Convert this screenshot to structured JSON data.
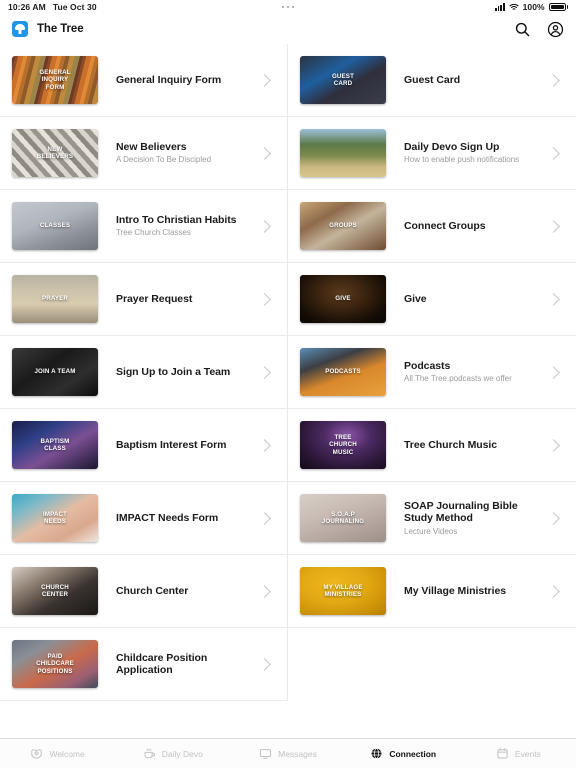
{
  "status_bar": {
    "time": "10:26 AM",
    "date": "Tue Oct 30",
    "battery_percent": "100%",
    "signal_icon": "cellular-signal-icon",
    "wifi_icon": "wifi-icon",
    "battery_icon": "battery-icon",
    "multitask_icon": "multitask-handle-icon"
  },
  "navbar": {
    "app_name": "The Tree",
    "logo_icon": "the-tree-logo-icon",
    "search_icon": "search-icon",
    "account_icon": "account-circle-icon",
    "brand_color": "#2196e8"
  },
  "list": {
    "chevron_icon": "chevron-right-icon",
    "items": [
      {
        "title": "General Inquiry Form",
        "subtitle": "",
        "thumb_label": "GENERAL\nINQUIRY\nFORM",
        "thumb_style": "general-inquiry",
        "column": "left"
      },
      {
        "title": "Guest Card",
        "subtitle": "",
        "thumb_label": "GUEST\nCARD",
        "thumb_style": "guest-card",
        "column": "right"
      },
      {
        "title": "New Believers",
        "subtitle": "A Decision To Be Discipled",
        "thumb_label": "NEW\nBELIEVERS",
        "thumb_style": "new-believers",
        "column": "left"
      },
      {
        "title": "Daily Devo Sign Up",
        "subtitle": "How to enable push notifications",
        "thumb_label": "",
        "thumb_style": "daily-devo",
        "column": "right"
      },
      {
        "title": "Intro To Christian Habits",
        "subtitle": "Tree Church Classes",
        "thumb_label": "CLASSES",
        "thumb_style": "classes",
        "column": "left"
      },
      {
        "title": "Connect Groups",
        "subtitle": "",
        "thumb_label": "GROUPS",
        "thumb_style": "groups",
        "column": "right"
      },
      {
        "title": "Prayer Request",
        "subtitle": "",
        "thumb_label": "PRAYER",
        "thumb_style": "prayer",
        "column": "left"
      },
      {
        "title": "Give",
        "subtitle": "",
        "thumb_label": "GIVE",
        "thumb_style": "give",
        "column": "right"
      },
      {
        "title": "Sign Up to Join a Team",
        "subtitle": "",
        "thumb_label": "JOIN A TEAM",
        "thumb_style": "join-a-team",
        "column": "left"
      },
      {
        "title": "Podcasts",
        "subtitle": "All The Tree podcasts we offer",
        "thumb_label": "PODCASTS",
        "thumb_style": "podcasts",
        "column": "right"
      },
      {
        "title": "Baptism Interest Form",
        "subtitle": "",
        "thumb_label": "BAPTISM\nCLASS",
        "thumb_style": "baptism",
        "column": "left"
      },
      {
        "title": "Tree Church Music",
        "subtitle": "",
        "thumb_label": "TREE\nCHURCH\nMUSIC",
        "thumb_style": "tree-music",
        "column": "right"
      },
      {
        "title": "IMPACT Needs Form",
        "subtitle": "",
        "thumb_label": "IMPACT\nNEEDS",
        "thumb_style": "impact",
        "column": "left"
      },
      {
        "title": "SOAP Journaling Bible Study Method",
        "subtitle": "Lecture Videos",
        "thumb_label": "S.O.A.P\nJOURNALING",
        "thumb_style": "soap",
        "column": "right"
      },
      {
        "title": "Church Center",
        "subtitle": "",
        "thumb_label": "CHURCH\nCENTER",
        "thumb_style": "church-center",
        "column": "left"
      },
      {
        "title": "My Village Ministries",
        "subtitle": "",
        "thumb_label": "MY VILLAGE\nMINISTRIES",
        "thumb_style": "my-village",
        "column": "right"
      },
      {
        "title": "Childcare Position Application",
        "subtitle": "",
        "thumb_label": "PAID\nCHILDCARE\nPOSITIONS",
        "thumb_style": "childcare",
        "column": "left"
      }
    ]
  },
  "tabbar": {
    "tabs": [
      {
        "label": "Welcome",
        "icon": "hand-heart-icon",
        "active": false
      },
      {
        "label": "Daily Devo",
        "icon": "coffee-cup-icon",
        "active": false
      },
      {
        "label": "Messages",
        "icon": "monitor-icon",
        "active": false
      },
      {
        "label": "Connection",
        "icon": "globe-icon",
        "active": true
      },
      {
        "label": "Events",
        "icon": "calendar-icon",
        "active": false
      }
    ]
  }
}
